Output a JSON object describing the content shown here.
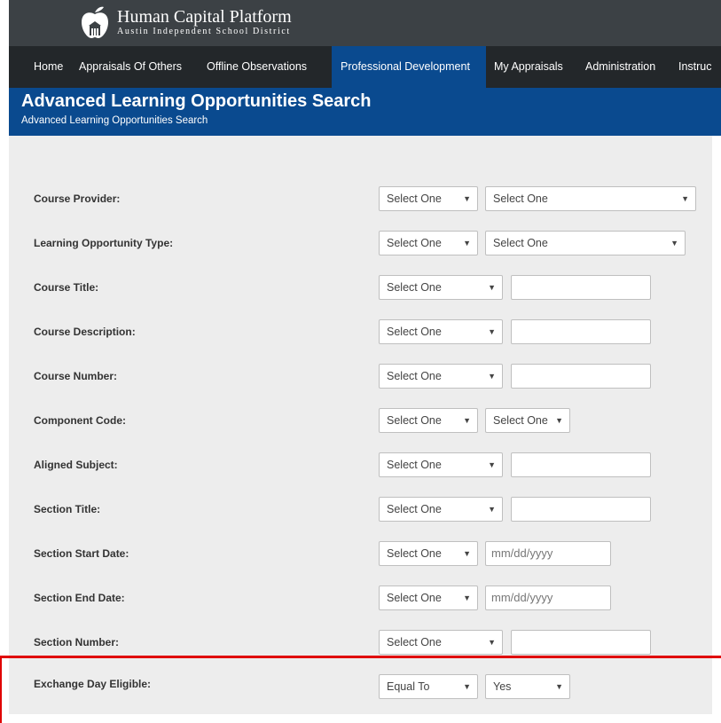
{
  "brand": {
    "title": "Human Capital Platform",
    "subtitle": "Austin Independent School District"
  },
  "nav": {
    "items": [
      "Home",
      "Appraisals Of Others",
      "Offline Observations",
      "Professional Development",
      "My Appraisals",
      "Administration",
      "Instruc"
    ],
    "active": "Professional Development"
  },
  "page": {
    "title": "Advanced Learning Opportunities Search",
    "breadcrumb": "Advanced Learning Opportunities Search"
  },
  "form": {
    "course_provider": {
      "label": "Course Provider:",
      "op": "Select One",
      "value": "Select One"
    },
    "learning_opportunity_type": {
      "label": "Learning Opportunity Type:",
      "op": "Select One",
      "value": "Select One"
    },
    "course_title": {
      "label": "Course Title:",
      "op": "Select One",
      "value": ""
    },
    "course_description": {
      "label": "Course Description:",
      "op": "Select One",
      "value": ""
    },
    "course_number": {
      "label": "Course Number:",
      "op": "Select One",
      "value": ""
    },
    "component_code": {
      "label": "Component Code:",
      "op": "Select One",
      "value": "Select One"
    },
    "aligned_subject": {
      "label": "Aligned Subject:",
      "op": "Select One",
      "value": ""
    },
    "section_title": {
      "label": "Section Title:",
      "op": "Select One",
      "value": ""
    },
    "section_start_date": {
      "label": "Section Start Date:",
      "op": "Select One",
      "placeholder": "mm/dd/yyyy"
    },
    "section_end_date": {
      "label": "Section End Date:",
      "op": "Select One",
      "placeholder": "mm/dd/yyyy"
    },
    "section_number": {
      "label": "Section Number:",
      "op": "Select One",
      "value": ""
    },
    "exchange_day_eligible": {
      "label": "Exchange Day Eligible:",
      "op": "Equal To",
      "value": "Yes"
    }
  },
  "colors": {
    "navbar": "#23272a",
    "topbar": "#3c4145",
    "accent": "#0a4a8f",
    "highlight": "#e00000"
  },
  "icons": {
    "logo": "apple-school-icon",
    "dropdown": "chevron-down-icon"
  }
}
